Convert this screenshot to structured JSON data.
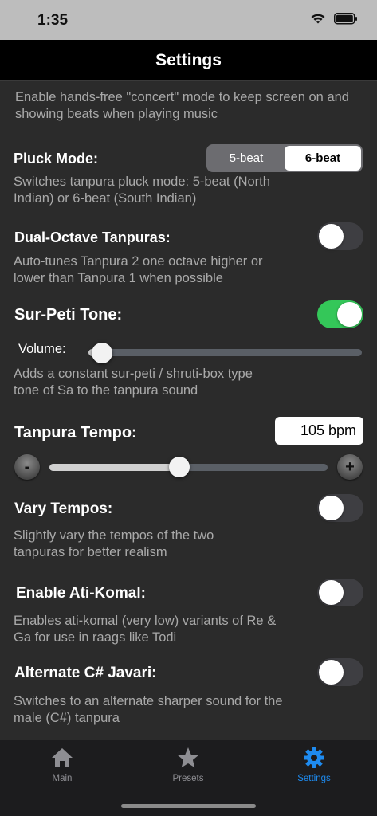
{
  "status_bar": {
    "time": "1:35"
  },
  "nav": {
    "title": "Settings"
  },
  "concert": {
    "description": "Enable hands-free \"concert\" mode to keep screen on and showing beats when playing music"
  },
  "pluck_mode": {
    "label": "Pluck Mode:",
    "options": [
      "5-beat",
      "6-beat"
    ],
    "selected": "6-beat",
    "description": "Switches tanpura pluck mode: 5-beat (North Indian) or 6-beat (South Indian)"
  },
  "dual_octave": {
    "label": "Dual-Octave Tanpuras:",
    "on": false,
    "description": "Auto-tunes Tanpura 2 one octave higher or lower than Tanpura 1 when possible"
  },
  "sur_peti": {
    "label": "Sur-Peti Tone:",
    "on": true,
    "volume_label": "Volume:",
    "volume_level": 0.05,
    "description": "Adds a constant sur-peti / shruti-box type tone of Sa to the tanpura sound"
  },
  "tempo": {
    "label": "Tanpura Tempo:",
    "value": "105 bpm",
    "slider_level": 0.466,
    "minus_label": "-",
    "plus_label": "+"
  },
  "vary_tempos": {
    "label": "Vary Tempos:",
    "on": false,
    "description": "Slightly vary the tempos of the two tanpuras for better realism"
  },
  "ati_komal": {
    "label": "Enable Ati-Komal:",
    "on": false,
    "description": "Enables ati-komal (very low) variants of Re & Ga for use in raags like Todi"
  },
  "javari": {
    "label": "Alternate C# Javari:",
    "on": false,
    "description": "Switches to an alternate sharper sound for the male (C#) tanpura"
  },
  "tabs": [
    {
      "label": "Main",
      "icon": "home-icon",
      "active": false
    },
    {
      "label": "Presets",
      "icon": "star-icon",
      "active": false
    },
    {
      "label": "Settings",
      "icon": "gear-icon",
      "active": true
    }
  ],
  "colors": {
    "accent_blue": "#1e8bf0",
    "toggle_on": "#34c759",
    "background": "#2b2b2b"
  }
}
